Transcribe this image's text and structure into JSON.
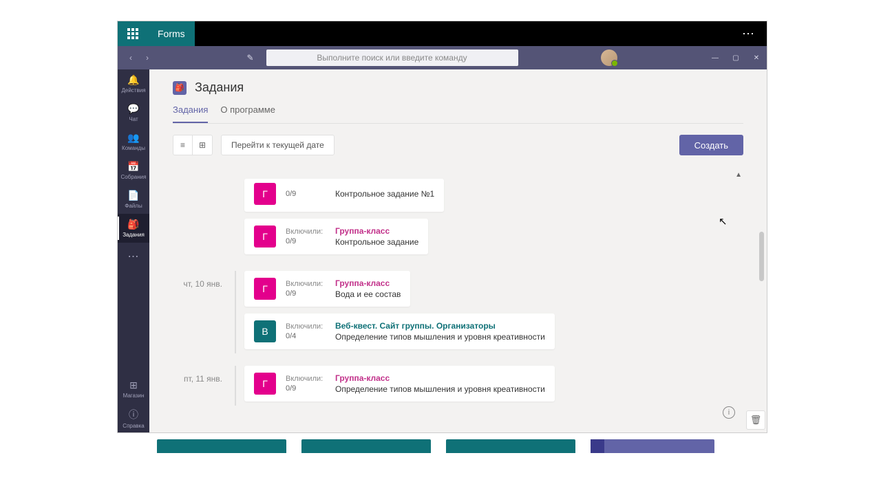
{
  "office": {
    "brand": "Forms"
  },
  "search": {
    "placeholder": "Выполните поиск или введите команду"
  },
  "rail": {
    "items": [
      {
        "label": "Действия"
      },
      {
        "label": "Чат"
      },
      {
        "label": "Команды"
      },
      {
        "label": "Собрания"
      },
      {
        "label": "Файлы"
      },
      {
        "label": "Задания"
      }
    ],
    "store": "Магазин",
    "help": "Справка"
  },
  "page": {
    "app_title": "Задания",
    "tabs": {
      "assignments": "Задания",
      "about": "О программе"
    },
    "jump": "Перейти к текущей дате",
    "create": "Создать"
  },
  "strings": {
    "included": "Включили:"
  },
  "dates": {
    "d1": "чт, 10 янв.",
    "d2": "пт, 11 янв."
  },
  "cards": {
    "c0": {
      "initial": "Г",
      "count": "0/9",
      "group": "",
      "title": "Контрольное задание №1"
    },
    "c1": {
      "initial": "Г",
      "count": "0/9",
      "group": "Группа-класс",
      "title": "Контрольное задание"
    },
    "c2": {
      "initial": "Г",
      "count": "0/9",
      "group": "Группа-класс",
      "title": "Вода и ее состав"
    },
    "c3": {
      "initial": "В",
      "count": "0/4",
      "group": "Веб-квест. Сайт группы. Организаторы",
      "title": "Определение типов мышления и уровня креативности"
    },
    "c4": {
      "initial": "Г",
      "count": "0/9",
      "group": "Группа-класс",
      "title": "Определение типов мышления и уровня креативности"
    }
  }
}
